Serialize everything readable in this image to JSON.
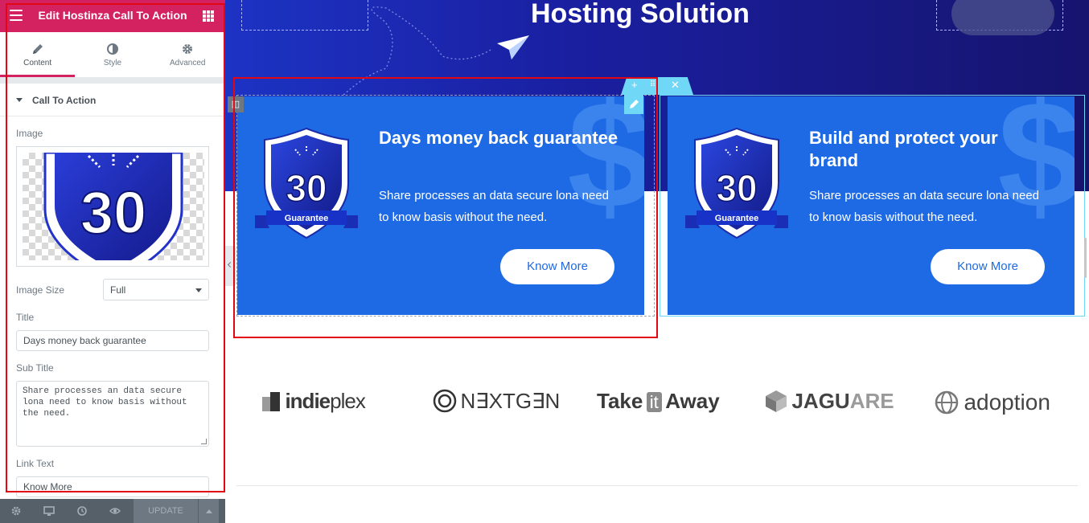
{
  "panel": {
    "header_title": "Edit Hostinza Call To Action",
    "tabs": [
      {
        "label": "Content",
        "icon": "pencil-icon"
      },
      {
        "label": "Style",
        "icon": "contrast-icon"
      },
      {
        "label": "Advanced",
        "icon": "gear-icon"
      }
    ],
    "section_title": "Call To Action",
    "image_label": "Image",
    "image_size_label": "Image Size",
    "image_size_value": "Full",
    "title_label": "Title",
    "title_value": "Days money back guarantee",
    "subtitle_label": "Sub Title",
    "subtitle_value": "Share processes an data secure lona need to know basis without the need.",
    "link_text_label": "Link Text",
    "link_text_value": "Know More",
    "update_label": "UPDATE",
    "footer_icons": [
      "gear-icon",
      "monitor-icon",
      "history-icon",
      "eye-icon"
    ]
  },
  "hero": {
    "title": "Hosting Solution"
  },
  "cards": [
    {
      "title": "Days money back guarantee",
      "subtitle": "Share processes an data secure lona need to know basis without the need.",
      "button": "Know More",
      "badge_number": "30",
      "badge_ribbon": "Guarantee"
    },
    {
      "title": "Build and protect your brand",
      "subtitle": "Share processes an data secure lona need to know basis without the need.",
      "button": "Know More",
      "badge_number": "30",
      "badge_ribbon": "Guarantee"
    }
  ],
  "logos": [
    {
      "name": "indieplex",
      "bold": "indie",
      "light": "plex"
    },
    {
      "name": "NEXTGEN",
      "text": "N∃XTG∃N"
    },
    {
      "name": "Take it Away",
      "a": "Take",
      "b": "it",
      "c": "Away"
    },
    {
      "name": "JAGUARE",
      "a": "JAGU",
      "b": "ARE"
    },
    {
      "name": "adoption",
      "text": "adoption"
    }
  ],
  "colors": {
    "panel_header": "#d4215f",
    "card_bg": "#1e6ae4",
    "hero_bg": "#1a1fa0",
    "highlight": "#e30613",
    "elementor_cyan": "#71d7f7"
  }
}
